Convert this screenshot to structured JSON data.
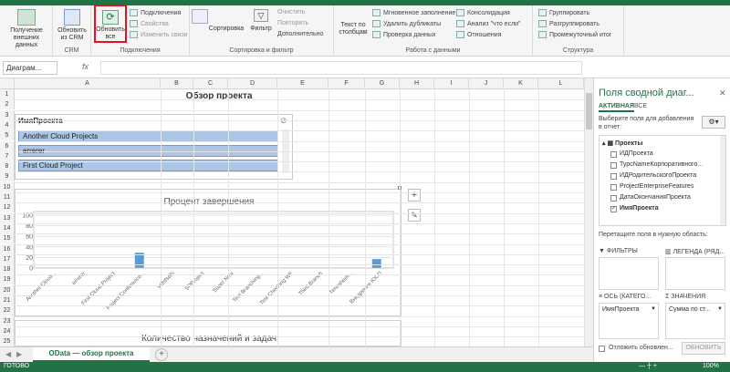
{
  "ribbon": {
    "groups": {
      "get_external": {
        "label": "Получение внешних данных"
      },
      "crm": {
        "label": "CRM",
        "refresh_crm": "Обновить из CRM"
      },
      "connections": {
        "label": "Подключения",
        "refresh_all": "Обновить все",
        "connections": "Подключения",
        "properties": "Свойства",
        "edit_links": "Изменить связи"
      },
      "sort_filter": {
        "label": "Сортировка и фильтр",
        "sort": "Сортировка",
        "filter": "Фильтр",
        "clear": "Очистить",
        "reapply": "Повторить",
        "advanced": "Дополнительно"
      },
      "data_tools": {
        "label": "Работа с данными",
        "text_to_columns": "Текст по столбцам",
        "flash_fill": "Мгновенное заполнение",
        "remove_dup": "Удалить дубликаты",
        "validation": "Проверка данных",
        "consolidate": "Консолидация",
        "whatif": "Анализ \"что если\"",
        "relations": "Отношения"
      },
      "outline": {
        "label": "Структура",
        "group": "Группировать",
        "ungroup": "Разгруппировать",
        "subtotal": "Промежуточный итог"
      }
    }
  },
  "formula_bar": {
    "name_box": "Диаграм...",
    "fx": "fx"
  },
  "columns": [
    "A",
    "B",
    "C",
    "D",
    "E",
    "F",
    "G",
    "H",
    "I",
    "J",
    "K",
    "L"
  ],
  "rows": [
    "1",
    "2",
    "3",
    "4",
    "5",
    "6",
    "7",
    "8",
    "9",
    "10",
    "11",
    "12",
    "13",
    "14",
    "15",
    "16",
    "17",
    "18",
    "19",
    "20",
    "21",
    "22",
    "23",
    "24",
    "25"
  ],
  "sheet": {
    "title": "Обзор проекта"
  },
  "slicer": {
    "header": "ИмяПроекта",
    "items": [
      "Another Cloud Projects",
      "errerer",
      "First Cloud Project"
    ]
  },
  "chart_data": {
    "type": "bar",
    "title": "Процент завершения",
    "categories": [
      "Another Cloud...",
      "errerer",
      "First Cloud Project",
      "Project Conference...",
      "sdfsfsdfs",
      "SPProject",
      "Super New",
      "Test Branching...",
      "Test Checking WF",
      "Third Branch",
      "Timesheet...",
      "Внедрение ЮСП"
    ],
    "values": [
      0,
      0,
      0,
      29,
      0,
      0,
      0,
      0,
      0,
      0,
      0,
      17
    ],
    "ylim": [
      0,
      100
    ],
    "yticks": [
      "0",
      "20",
      "40",
      "60",
      "80",
      "100"
    ],
    "bar_color": "#5b9bd5"
  },
  "chart2": {
    "title": "Количество назначений и задач"
  },
  "pane": {
    "title": "Поля сводной диаг...",
    "tab_active": "АКТИВНАЯ",
    "tab_all": "ВСЕ",
    "instruction": "Выберите поля для добавления в отчет:",
    "table_name": "Проекты",
    "fields": [
      {
        "name": "ИДПроекта",
        "checked": false
      },
      {
        "name": "ТурсNameКорпоративного...",
        "checked": false
      },
      {
        "name": "ИДРодительскогоПроекта",
        "checked": false
      },
      {
        "name": "ProjectEnterpriseFeatures",
        "checked": false
      },
      {
        "name": "ДатаОкончанияПроекта",
        "checked": false
      },
      {
        "name": "ИмяПроекта",
        "checked": true
      }
    ],
    "drag_hint": "Перетащите поля в нужную область:",
    "filters": "ФИЛЬТРЫ",
    "legend": "ЛЕГЕНДА (РЯД...",
    "axis": "ОСЬ (КАТЕГО...",
    "values": "ЗНАЧЕНИЯ",
    "axis_item": "ИмяПроекта",
    "values_item": "Сумма по ст...",
    "defer": "Отложить обновлен...",
    "update": "ОБНОВИТЬ"
  },
  "sheet_tab": "OData — обзор проекта",
  "status": {
    "ready": "ГОТОВО",
    "zoom": "100%"
  },
  "colors": {
    "accent": "#217346",
    "slicer_item": "#aec6e6",
    "highlight": "#e81123"
  }
}
